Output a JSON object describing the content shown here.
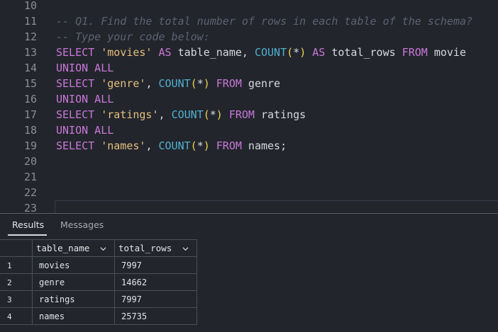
{
  "editor": {
    "lines": [
      {
        "num": "10",
        "tokens": []
      },
      {
        "num": "11",
        "tokens": [
          {
            "t": "-- Q1. Find the total number of rows in each table of the schema?",
            "c": "cmt"
          }
        ]
      },
      {
        "num": "12",
        "tokens": [
          {
            "t": "-- Type your code below:",
            "c": "cmt"
          }
        ]
      },
      {
        "num": "13",
        "tokens": [
          {
            "t": "SELECT",
            "c": "kw"
          },
          {
            "t": " ",
            "c": "plain"
          },
          {
            "t": "'movies'",
            "c": "str"
          },
          {
            "t": " ",
            "c": "plain"
          },
          {
            "t": "AS",
            "c": "kw"
          },
          {
            "t": " table_name, ",
            "c": "plain"
          },
          {
            "t": "COUNT",
            "c": "fn"
          },
          {
            "t": "(",
            "c": "paren"
          },
          {
            "t": "*",
            "c": "plain"
          },
          {
            "t": ")",
            "c": "paren"
          },
          {
            "t": " ",
            "c": "plain"
          },
          {
            "t": "AS",
            "c": "kw"
          },
          {
            "t": " total_rows ",
            "c": "plain"
          },
          {
            "t": "FROM",
            "c": "kw"
          },
          {
            "t": " movie",
            "c": "plain"
          }
        ]
      },
      {
        "num": "14",
        "tokens": [
          {
            "t": "UNION ALL",
            "c": "kw"
          }
        ]
      },
      {
        "num": "15",
        "tokens": [
          {
            "t": "SELECT",
            "c": "kw"
          },
          {
            "t": " ",
            "c": "plain"
          },
          {
            "t": "'genre'",
            "c": "str"
          },
          {
            "t": ", ",
            "c": "plain"
          },
          {
            "t": "COUNT",
            "c": "fn"
          },
          {
            "t": "(",
            "c": "paren"
          },
          {
            "t": "*",
            "c": "plain"
          },
          {
            "t": ")",
            "c": "paren"
          },
          {
            "t": " ",
            "c": "plain"
          },
          {
            "t": "FROM",
            "c": "kw"
          },
          {
            "t": " genre",
            "c": "plain"
          }
        ]
      },
      {
        "num": "16",
        "tokens": [
          {
            "t": "UNION ALL",
            "c": "kw"
          }
        ]
      },
      {
        "num": "17",
        "tokens": [
          {
            "t": "SELECT",
            "c": "kw"
          },
          {
            "t": " ",
            "c": "plain"
          },
          {
            "t": "'ratings'",
            "c": "str"
          },
          {
            "t": ", ",
            "c": "plain"
          },
          {
            "t": "COUNT",
            "c": "fn"
          },
          {
            "t": "(",
            "c": "paren"
          },
          {
            "t": "*",
            "c": "plain"
          },
          {
            "t": ")",
            "c": "paren"
          },
          {
            "t": " ",
            "c": "plain"
          },
          {
            "t": "FROM",
            "c": "kw"
          },
          {
            "t": " ratings",
            "c": "plain"
          }
        ]
      },
      {
        "num": "18",
        "tokens": [
          {
            "t": "UNION ALL",
            "c": "kw"
          }
        ]
      },
      {
        "num": "19",
        "tokens": [
          {
            "t": "SELECT",
            "c": "kw"
          },
          {
            "t": " ",
            "c": "plain"
          },
          {
            "t": "'names'",
            "c": "str"
          },
          {
            "t": ", ",
            "c": "plain"
          },
          {
            "t": "COUNT",
            "c": "fn"
          },
          {
            "t": "(",
            "c": "paren"
          },
          {
            "t": "*",
            "c": "plain"
          },
          {
            "t": ")",
            "c": "paren"
          },
          {
            "t": " ",
            "c": "plain"
          },
          {
            "t": "FROM",
            "c": "kw"
          },
          {
            "t": " names;",
            "c": "plain"
          }
        ]
      },
      {
        "num": "20",
        "tokens": []
      },
      {
        "num": "21",
        "tokens": []
      },
      {
        "num": "22",
        "tokens": []
      },
      {
        "num": "23",
        "tokens": []
      }
    ]
  },
  "results": {
    "tabs": {
      "results": "Results",
      "messages": "Messages"
    },
    "columns": [
      "table_name",
      "total_rows"
    ],
    "rows": [
      {
        "n": "1",
        "table_name": "movies",
        "total_rows": "7997"
      },
      {
        "n": "2",
        "table_name": "genre",
        "total_rows": "14662"
      },
      {
        "n": "3",
        "table_name": "ratings",
        "total_rows": "7997"
      },
      {
        "n": "4",
        "table_name": "names",
        "total_rows": "25735"
      }
    ]
  },
  "colors": {
    "background": "#23252d",
    "keyword": "#c879d6",
    "string": "#e5c07b",
    "function": "#4fb1cf",
    "comment": "#5d6270"
  }
}
